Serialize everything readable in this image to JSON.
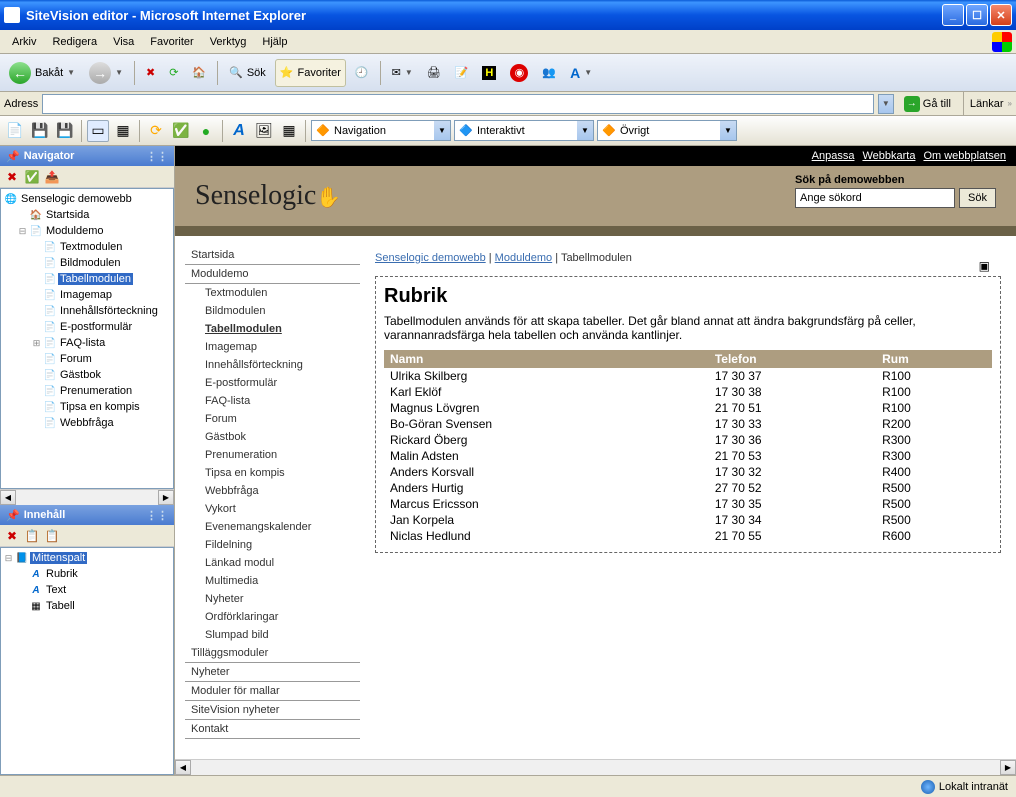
{
  "window": {
    "title": "SiteVision editor - Microsoft Internet Explorer"
  },
  "menubar": [
    "Arkiv",
    "Redigera",
    "Visa",
    "Favoriter",
    "Verktyg",
    "Hjälp"
  ],
  "ie_toolbar": {
    "back": "Bakåt",
    "search": "Sök",
    "favorites": "Favoriter"
  },
  "addressbar": {
    "label": "Adress",
    "go": "Gå till",
    "links": "Länkar"
  },
  "sv_dropdowns": {
    "nav": "Navigation",
    "inter": "Interaktivt",
    "other": "Övrigt"
  },
  "navigator": {
    "title": "Navigator",
    "root": "Senselogic demowebb",
    "items": [
      {
        "label": "Startsida",
        "indent": 1,
        "icon": "🏠"
      },
      {
        "label": "Moduldemo",
        "indent": 1,
        "icon": "📄",
        "exp": "⊟"
      },
      {
        "label": "Textmodulen",
        "indent": 2,
        "icon": "📄"
      },
      {
        "label": "Bildmodulen",
        "indent": 2,
        "icon": "📄"
      },
      {
        "label": "Tabellmodulen",
        "indent": 2,
        "icon": "📄",
        "selected": true
      },
      {
        "label": "Imagemap",
        "indent": 2,
        "icon": "📄"
      },
      {
        "label": "Innehållsförteckning",
        "indent": 2,
        "icon": "📄"
      },
      {
        "label": "E-postformulär",
        "indent": 2,
        "icon": "📄"
      },
      {
        "label": "FAQ-lista",
        "indent": 2,
        "icon": "📄",
        "exp": "⊞"
      },
      {
        "label": "Forum",
        "indent": 2,
        "icon": "📄"
      },
      {
        "label": "Gästbok",
        "indent": 2,
        "icon": "📄"
      },
      {
        "label": "Prenumeration",
        "indent": 2,
        "icon": "📄"
      },
      {
        "label": "Tipsa en kompis",
        "indent": 2,
        "icon": "📄"
      },
      {
        "label": "Webbfråga",
        "indent": 2,
        "icon": "📄"
      }
    ]
  },
  "content_panel": {
    "title": "Innehåll",
    "items": [
      {
        "label": "Mittenspalt",
        "indent": 0,
        "icon": "📘",
        "exp": "⊟",
        "selected": true
      },
      {
        "label": "Rubrik",
        "indent": 1,
        "icon": "A"
      },
      {
        "label": "Text",
        "indent": 1,
        "icon": "A"
      },
      {
        "label": "Tabell",
        "indent": 1,
        "icon": "▦"
      }
    ]
  },
  "page": {
    "top_links": [
      "Anpassa",
      "Webbkarta",
      "Om webbplatsen"
    ],
    "logo": "Senselogic",
    "search_label": "Sök på demowebben",
    "search_placeholder": "Ange sökord",
    "search_btn": "Sök",
    "breadcrumb": {
      "a": "Senselogic demowebb",
      "b": "Moduldemo",
      "c": "Tabellmodulen"
    },
    "heading": "Rubrik",
    "desc": "Tabellmodulen används för att skapa tabeller. Det går bland annat att ändra bakgrundsfärg på celler, varannanradsfärga hela tabellen och använda kantlinjer.",
    "sidenav_top": [
      "Startsida",
      "Moduldemo"
    ],
    "sidenav_sub": [
      "Textmodulen",
      "Bildmodulen",
      "Tabellmodulen",
      "Imagemap",
      "Innehållsförteckning",
      "E-postformulär",
      "FAQ-lista",
      "Forum",
      "Gästbok",
      "Prenumeration",
      "Tipsa en kompis",
      "Webbfråga",
      "Vykort",
      "Evenemangskalender",
      "Fildelning",
      "Länkad modul",
      "Multimedia",
      "Nyheter",
      "Ordförklaringar",
      "Slumpad bild"
    ],
    "sidenav_bottom": [
      "Tilläggsmoduler",
      "Nyheter",
      "Moduler för mallar",
      "SiteVision nyheter",
      "Kontakt"
    ],
    "table": {
      "headers": [
        "Namn",
        "Telefon",
        "Rum"
      ],
      "rows": [
        [
          "Ulrika Skilberg",
          "17 30 37",
          "R100"
        ],
        [
          "Karl Eklöf",
          "17 30 38",
          "R100"
        ],
        [
          "Magnus Lövgren",
          "21 70 51",
          "R100"
        ],
        [
          "Bo-Göran Svensen",
          "17 30 33",
          "R200"
        ],
        [
          "Rickard Öberg",
          "17 30 36",
          "R300"
        ],
        [
          "Malin Adsten",
          "21 70 53",
          "R300"
        ],
        [
          "Anders Korsvall",
          "17 30 32",
          "R400"
        ],
        [
          "Anders Hurtig",
          "27 70 52",
          "R500"
        ],
        [
          "Marcus Ericsson",
          "17 30 35",
          "R500"
        ],
        [
          "Jan Korpela",
          "17 30 34",
          "R500"
        ],
        [
          "Niclas Hedlund",
          "21 70 55",
          "R600"
        ]
      ]
    }
  },
  "statusbar": {
    "zone": "Lokalt intranät"
  }
}
